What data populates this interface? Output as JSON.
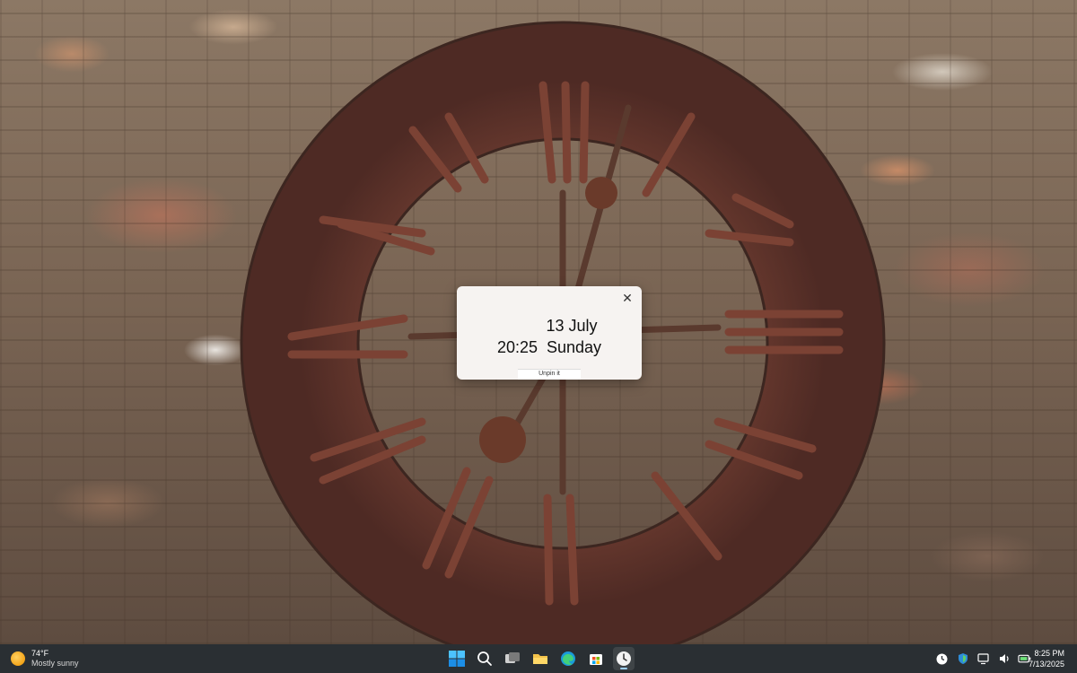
{
  "popup": {
    "date": "13 July",
    "time": "20:25",
    "weekday": "Sunday",
    "close_glyph": "✕",
    "unpin_label": "Unpin it"
  },
  "taskbar": {
    "weather": {
      "temp": "74°F",
      "desc": "Mostly sunny",
      "icon": "sun-icon"
    },
    "apps": [
      {
        "name": "windows-start-icon"
      },
      {
        "name": "search-icon"
      },
      {
        "name": "task-view-icon"
      },
      {
        "name": "file-explorer-icon"
      },
      {
        "name": "edge-browser-icon"
      },
      {
        "name": "microsoft-store-icon"
      },
      {
        "name": "clock-app-icon",
        "active": true
      }
    ],
    "tray": [
      {
        "name": "clock-tray-icon"
      },
      {
        "name": "security-shield-icon"
      },
      {
        "name": "network-icon"
      },
      {
        "name": "volume-icon"
      },
      {
        "name": "battery-icon"
      }
    ],
    "clock": {
      "time": "8:25 PM",
      "date": "7/13/2025"
    }
  },
  "colors": {
    "taskbar_bg": "#2a2f33",
    "popup_bg": "#f6f3f1",
    "rust": "#6f3a2e",
    "accent": "#9fd0ff"
  }
}
